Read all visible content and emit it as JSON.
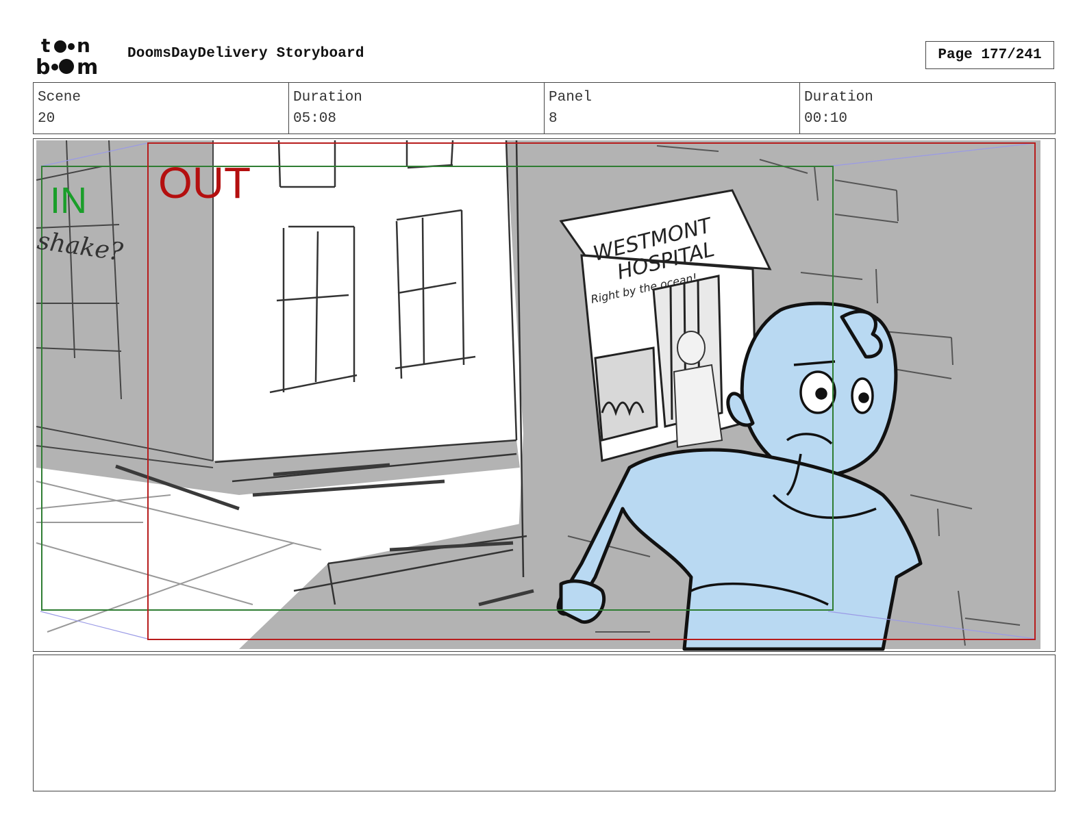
{
  "header": {
    "doc_title": "DoomsDayDelivery Storyboard",
    "page_label": "Page 177/241",
    "logo_text": "toon boom"
  },
  "info": [
    {
      "label": "Scene",
      "value": "20"
    },
    {
      "label": "Duration",
      "value": "05:08"
    },
    {
      "label": "Panel",
      "value": "8"
    },
    {
      "label": "Duration",
      "value": "00:10"
    }
  ],
  "panel": {
    "in_label": "IN",
    "out_label": "OUT",
    "note_text": "shake?",
    "sign_line1": "WESTMONT",
    "sign_line2": "HOSPITAL",
    "poster_text": "Right by the ocean!",
    "colors": {
      "in_frame": "#2e7d32",
      "out_frame": "#b71c1c",
      "character_fill": "#b9d9f2",
      "wall_fill": "#b3b3b3"
    }
  },
  "notes": {
    "text": ""
  }
}
